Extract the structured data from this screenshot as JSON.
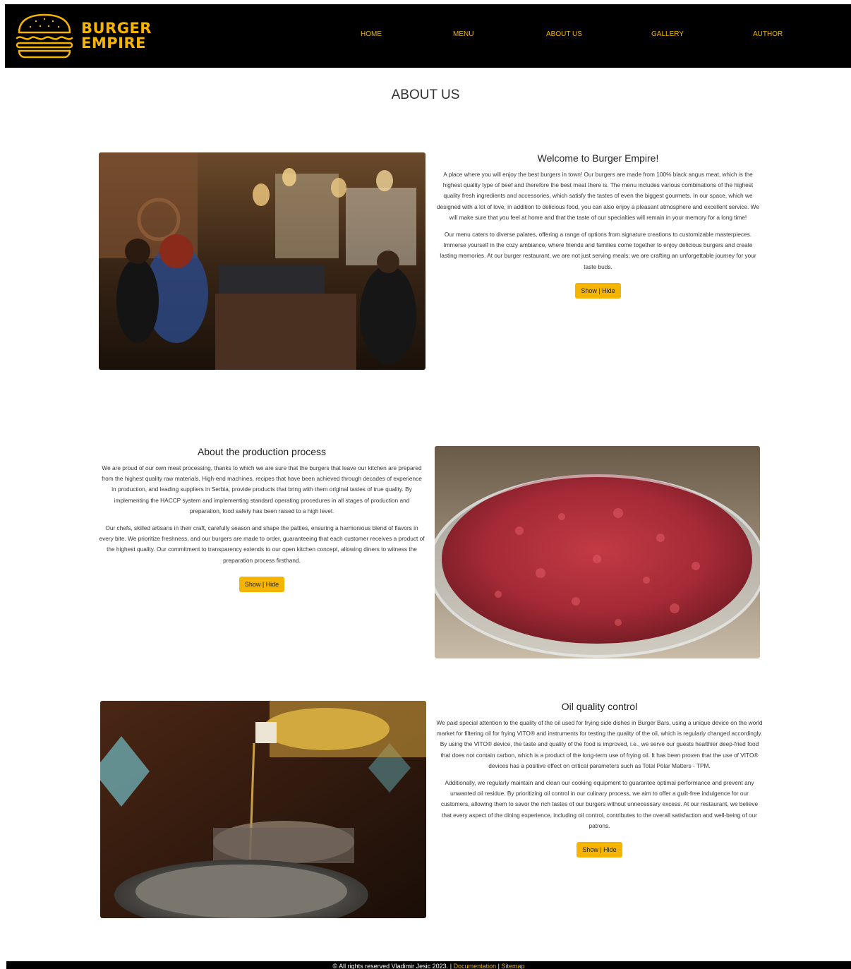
{
  "brand": {
    "line1": "BURGER",
    "line2": "EMPIRE",
    "accent": "#f5b400"
  },
  "nav": [
    {
      "label": "HOME"
    },
    {
      "label": "MENU"
    },
    {
      "label": "ABOUT US"
    },
    {
      "label": "GALLERY"
    },
    {
      "label": "AUTHOR"
    }
  ],
  "page": {
    "title": "ABOUT US"
  },
  "sections": [
    {
      "heading": "Welcome to Burger Empire!",
      "paragraphs": [
        "A place where you will enjoy the best burgers in town! Our burgers are made from 100% black angus meat, which is the highest quality type of beef and therefore the best meat there is. The menu includes various combinations of the highest quality fresh ingredients and accessories, which satisfy the tastes of even the biggest gourmets. In our space, which we designed with a lot of love, in addition to delicious food, you can also enjoy a pleasant atmosphere and excellent service. We will make sure that you feel at home and that the taste of our specialties will remain in your memory for a long time!",
        "Our menu caters to diverse palates, offering a range of options from signature creations to customizable masterpieces. Immerse yourself in the cozy ambiance, where friends and families come together to enjoy delicious burgers and create lasting memories. At our burger restaurant, we are not just serving meals; we are crafting an unforgettable journey for your taste buds."
      ],
      "button": "Show | Hide"
    },
    {
      "heading": "About the production process",
      "paragraphs": [
        "We are proud of our own meat processing, thanks to which we are sure that the burgers that leave our kitchen are prepared from the highest quality raw materials. High-end machines, recipes that have been achieved through decades of experience in production, and leading suppliers in Serbia, provide products that bring with them original tastes of true quality. By implementing the HACCP system and implementing standard operating procedures in all stages of production and preparation, food safety has been raised to a high level.",
        "Our chefs, skilled artisans in their craft, carefully season and shape the patties, ensuring a harmonious blend of flavors in every bite. We prioritize freshness, and our burgers are made to order, guaranteeing that each customer receives a product of the highest quality. Our commitment to transparency extends to our open kitchen concept, allowing diners to witness the preparation process firsthand."
      ],
      "button": "Show | Hide"
    },
    {
      "heading": "Oil quality control",
      "paragraphs": [
        "We paid special attention to the quality of the oil used for frying side dishes in Burger Bars, using a unique device on the world market for filtering oil for frying VITO® and instruments for testing the quality of the oil, which is regularly changed accordingly. By using the VITO® device, the taste and quality of the food is improved, i.e., we serve our guests healthier deep-fried food that does not contain carbon, which is a product of the long-term use of frying oil. It has been proven that the use of VITO® devices has a positive effect on critical parameters such as Total Polar Matters - TPM.",
        "Additionally, we regularly maintain and clean our cooking equipment to guarantee optimal performance and prevent any unwanted oil residue. By prioritizing oil control in our culinary process, we aim to offer a guilt-free indulgence for our customers, allowing them to savor the rich tastes of our burgers without unnecessary excess. At our restaurant, we believe that every aspect of the dining experience, including oil control, contributes to the overall satisfaction and well-being of our patrons."
      ],
      "button": "Show | Hide"
    }
  ],
  "footer": {
    "copyright": "© All rights reserved Vladimir Jesic 2023.",
    "separator": "|",
    "documentation": "Documentation",
    "sitemap": "Sitemap"
  }
}
